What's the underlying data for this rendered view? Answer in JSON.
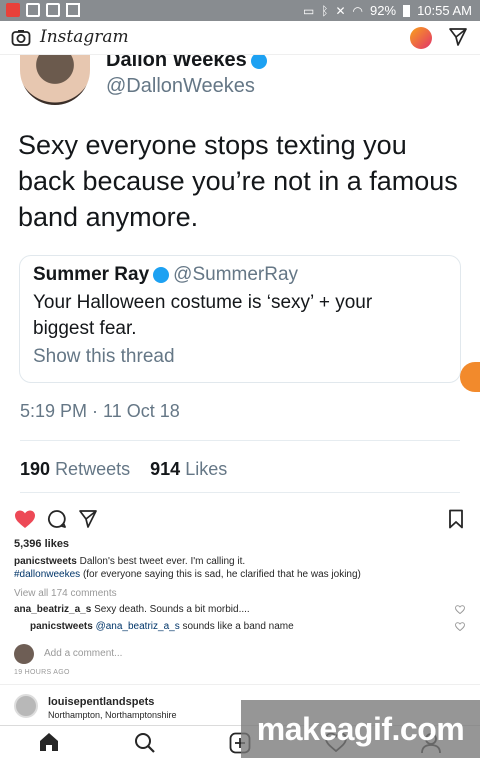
{
  "status_bar": {
    "battery": "92%",
    "time": "10:55 AM",
    "colors": {
      "bg": "#888c90",
      "app_icon_red": "#e8413a"
    }
  },
  "header": {
    "logo": "Instagram",
    "camera_icon": "camera-icon",
    "igtv_icon": "igtv-icon",
    "send_icon": "direct-send-icon"
  },
  "tweet": {
    "name": "Dallon Weekes",
    "handle": "@DallonWeekes",
    "text": "Sexy everyone stops texting you back because you’re not in a famous band anymore.",
    "quote": {
      "name": "Summer Ray",
      "handle": "@SummerRay",
      "text": "Your Halloween costume is ‘sexy’ + your biggest fear.",
      "link": "Show this thread"
    },
    "time": "5:19 PM · 11 Oct 18",
    "retweets_count": "190",
    "retweets_label": "Retweets",
    "likes_count": "914",
    "likes_label": "Likes",
    "colors": {
      "verified": "#1da1f2",
      "secondary": "#657786"
    }
  },
  "post": {
    "likes": "5,396 likes",
    "caption_user": "panicstweets",
    "caption_text": "Dallon's best tweet ever. I'm calling it.",
    "caption_tag": "#dallonweekes",
    "caption_rest": "(for everyone saying this is sad, he clarified that he was joking)",
    "view_all": "View all 174 comments",
    "comments": [
      {
        "user": "ana_beatriz_a_s",
        "text": "Sexy death. Sounds a bit morbid...."
      },
      {
        "user": "panicstweets",
        "mention": "@ana_beatriz_a_s",
        "text": "sounds like a band name"
      }
    ],
    "add_comment_placeholder": "Add a comment...",
    "time_ago": "19 HOURS AGO",
    "liked_color": "#ed4956"
  },
  "next_post": {
    "user": "louisepentlandspets",
    "location": "Northampton, Northamptonshire"
  },
  "nav": {
    "items": [
      "home-icon",
      "search-icon",
      "new-post-icon",
      "activity-icon",
      "profile-icon"
    ]
  },
  "watermark": "makeagif.com"
}
